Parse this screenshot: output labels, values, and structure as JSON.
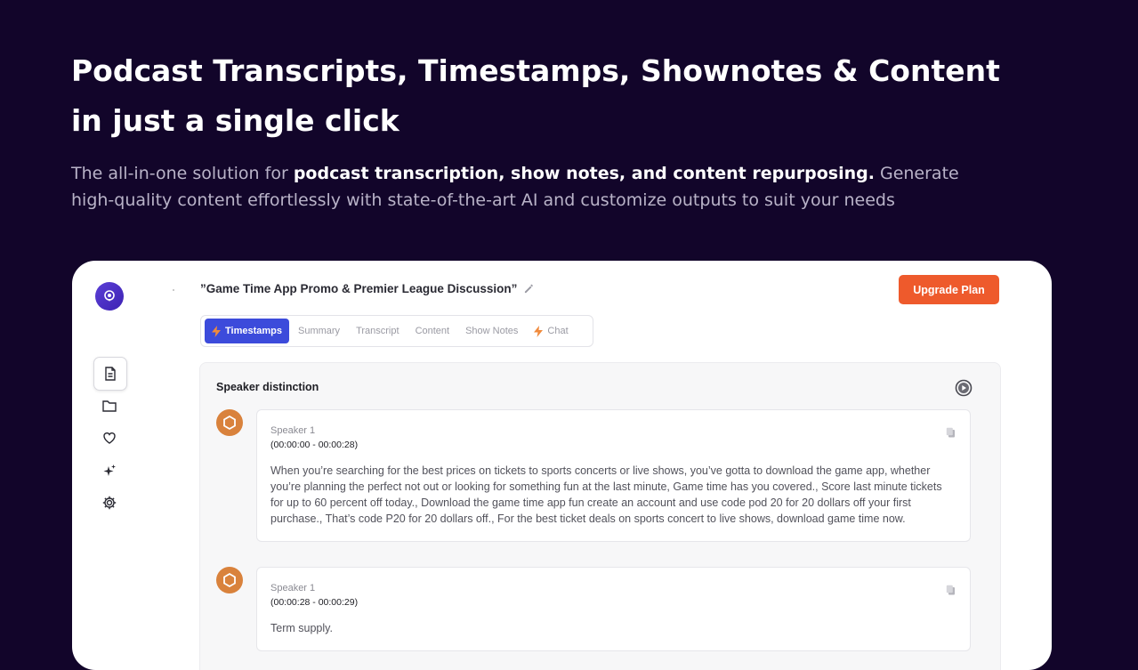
{
  "hero": {
    "title_line1": "Podcast Transcripts, Timestamps, Shownotes & Content",
    "title_line2": "in just a single click",
    "subtitle_pre": "The all-in-one solution for ",
    "subtitle_bold": "podcast transcription, show notes, and content repurposing.",
    "subtitle_post": " Generate high-quality content effortlessly with state-of-the-art AI and customize outputs to suit your needs"
  },
  "app": {
    "document_title": "”Game Time App Promo & Premier League Discussion”",
    "upgrade_label": "Upgrade Plan",
    "sidebar": {
      "icons": [
        "document-icon",
        "folder-icon",
        "heart-icon",
        "sparkles-icon",
        "gear-icon"
      ],
      "active": "document-icon"
    },
    "tabs": [
      {
        "label": "Timestamps",
        "active": true,
        "icon": "lightning-icon"
      },
      {
        "label": "Summary"
      },
      {
        "label": "Transcript"
      },
      {
        "label": "Content"
      },
      {
        "label": "Show Notes"
      },
      {
        "label": "Chat",
        "icon": "lightning-icon"
      }
    ],
    "panel": {
      "title": "Speaker distinction",
      "entries": [
        {
          "speaker": "Speaker 1",
          "time": "(00:00:00 - 00:00:28)",
          "text": "When you’re searching for the best prices on tickets to sports concerts or live shows, you’ve gotta to download the game app, whether you’re planning the perfect not out or looking for something fun at the last minute, Game time has you covered., Score last minute tickets for up to 60 percent off today., Download the game time app fun create an account and use code pod 20 for 20 dollars off your first purchase., That’s code P20 for 20 dollars off., For the best ticket deals on sports concert to live shows, download game time now."
        },
        {
          "speaker": "Speaker 1",
          "time": "(00:00:28 - 00:00:29)",
          "text": "Term supply."
        }
      ]
    },
    "colors": {
      "background": "#12052a",
      "accent": "#ee5a2c",
      "tab_active": "#3c4bdb",
      "avatar": "#d9823c"
    }
  }
}
